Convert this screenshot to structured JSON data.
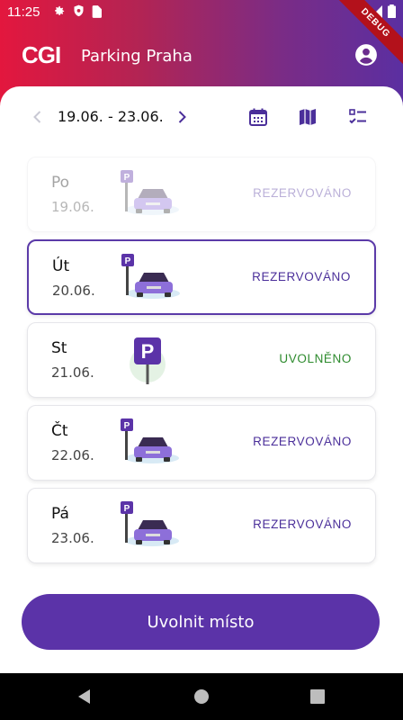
{
  "status_bar": {
    "time": "11:25"
  },
  "debug_ribbon": "DEBUG",
  "app_bar": {
    "logo": "CGI",
    "title": "Parking Praha"
  },
  "week": {
    "range": "19.06. - 23.06."
  },
  "days": [
    {
      "name": "Po",
      "date": "19.06.",
      "status": "REZERVOVÁNO",
      "icon": "parked-car-icon"
    },
    {
      "name": "Út",
      "date": "20.06.",
      "status": "REZERVOVÁNO",
      "icon": "parked-car-icon"
    },
    {
      "name": "St",
      "date": "21.06.",
      "status": "UVOLNĚNO",
      "icon": "parking-sign-icon"
    },
    {
      "name": "Čt",
      "date": "22.06.",
      "status": "REZERVOVÁNO",
      "icon": "parked-car-icon"
    },
    {
      "name": "Pá",
      "date": "23.06.",
      "status": "REZERVOVÁNO",
      "icon": "parked-car-icon"
    }
  ],
  "actions": {
    "release_label": "Uvolnit místo"
  },
  "colors": {
    "accent": "#5b33a8",
    "reserved": "#4b2f9a",
    "released": "#2e8b2e",
    "brand": "#e31937"
  }
}
